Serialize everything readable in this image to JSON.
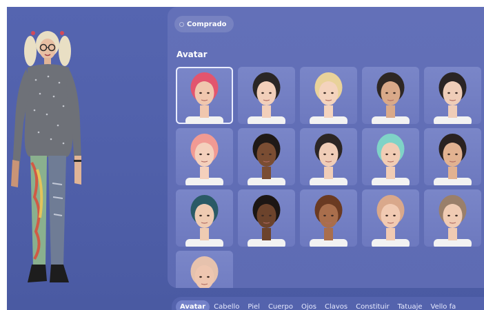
{
  "filter": {
    "label": "Comprado",
    "icon": "circle-icon"
  },
  "section_title": "Avatar",
  "avatars": [
    {
      "id": "avatar-1",
      "hair": "#e2556e",
      "skin": "#f0c7ae",
      "selected": true
    },
    {
      "id": "avatar-2",
      "hair": "#2a2626",
      "skin": "#f2cfba"
    },
    {
      "id": "avatar-3",
      "hair": "#e9d29a",
      "skin": "#f4d3bd"
    },
    {
      "id": "avatar-4",
      "hair": "#2e2724",
      "skin": "#d9a989"
    },
    {
      "id": "avatar-5",
      "hair": "#2a2424",
      "skin": "#efcdb8"
    },
    {
      "id": "avatar-6",
      "hair": "#f19a93",
      "skin": "#f4d0bc"
    },
    {
      "id": "avatar-7",
      "hair": "#1f1917",
      "skin": "#7a4d33"
    },
    {
      "id": "avatar-8",
      "hair": "#2c2625",
      "skin": "#f0cdb7"
    },
    {
      "id": "avatar-9",
      "hair": "#7fd3c7",
      "skin": "#f1ccb4"
    },
    {
      "id": "avatar-10",
      "hair": "#2a2221",
      "skin": "#e2b291"
    },
    {
      "id": "avatar-11",
      "hair": "#2a5a66",
      "skin": "#efcbb2"
    },
    {
      "id": "avatar-12",
      "hair": "#1c1614",
      "skin": "#6c432c"
    },
    {
      "id": "avatar-13",
      "hair": "#6a3a22",
      "skin": "#a96e4c"
    },
    {
      "id": "avatar-14",
      "hair": "#d9a88b",
      "skin": "#f1cab2"
    },
    {
      "id": "avatar-15",
      "hair": "#9a7f6a",
      "skin": "#f0cbb3"
    },
    {
      "id": "avatar-16",
      "hair": "#e6c2ad",
      "skin": "#eec6b0"
    }
  ],
  "tabs": [
    {
      "label": "Avatar",
      "active": true
    },
    {
      "label": "Cabello"
    },
    {
      "label": "Piel"
    },
    {
      "label": "Cuerpo"
    },
    {
      "label": "Ojos"
    },
    {
      "label": "Clavos"
    },
    {
      "label": "Constituir"
    },
    {
      "label": "Tatuaje"
    },
    {
      "label": "Vello fa"
    }
  ]
}
